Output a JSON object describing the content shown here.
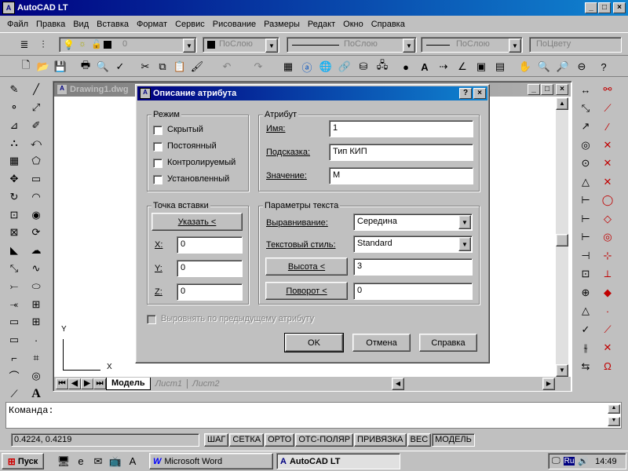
{
  "app": {
    "title": "AutoCAD LT"
  },
  "menu": [
    "Файл",
    "Правка",
    "Вид",
    "Вставка",
    "Формат",
    "Сервис",
    "Рисование",
    "Размеры",
    "Редакт",
    "Окно",
    "Справка"
  ],
  "layers": {
    "current": "0",
    "color": "ПоСлою",
    "linetype": "ПоСлою",
    "lineweight": "ПоСлою",
    "plotstyle": "ПоЦвету"
  },
  "drawing": {
    "title": "Drawing1.dwg",
    "tabs": [
      "Модель",
      "Лист1",
      "Лист2"
    ],
    "ucs_y": "Y",
    "ucs_x": "X"
  },
  "command": {
    "prompt": "Команда:"
  },
  "status": {
    "coords": "0.4224, 0.4219",
    "toggles": [
      "ШАГ",
      "СЕТКА",
      "ОРТО",
      "ОТС-ПОЛЯР",
      "ПРИВЯЗКА",
      "ВЕС",
      "МОДЕЛЬ"
    ]
  },
  "taskbar": {
    "start": "Пуск",
    "tasks": [
      "Microsoft Word",
      "AutoCAD LT"
    ],
    "lang": "Ru",
    "time": "14:49"
  },
  "dialog": {
    "title": "Описание атрибута",
    "mode": {
      "title": "Режим",
      "options": [
        {
          "label": "Скрытый",
          "checked": false
        },
        {
          "label": "Постоянный",
          "checked": false
        },
        {
          "label": "Контролируемый",
          "checked": false
        },
        {
          "label": "Установленный",
          "checked": false
        }
      ]
    },
    "attribute": {
      "title": "Атрибут",
      "name_label": "Имя:",
      "name_value": "1",
      "prompt_label": "Подсказка:",
      "prompt_value": "Тип КИП",
      "value_label": "Значение:",
      "value_value": "М"
    },
    "insert": {
      "title": "Точка вставки",
      "pick_button": "Указать <",
      "x_label": "X:",
      "x": "0",
      "y_label": "Y:",
      "y": "0",
      "z_label": "Z:",
      "z": "0"
    },
    "text": {
      "title": "Параметры текста",
      "justify_label": "Выравнивание:",
      "justify_value": "Середина",
      "style_label": "Текстовый стиль:",
      "style_value": "Standard",
      "height_button": "Высота <",
      "height_value": "3",
      "rotation_button": "Поворот <",
      "rotation_value": "0"
    },
    "align_prev": "Выровнять по предыдущему атрибуту",
    "ok": "OK",
    "cancel": "Отмена",
    "help": "Справка"
  },
  "colors": {
    "title_start": "#000080",
    "title_end": "#1084d0",
    "face": "#c0c0c0",
    "canvas": "#ffffff"
  }
}
